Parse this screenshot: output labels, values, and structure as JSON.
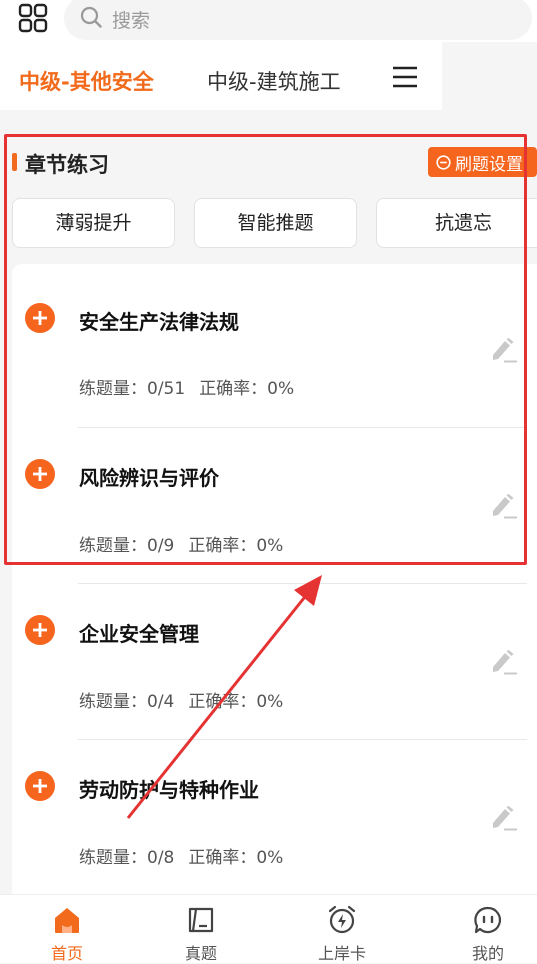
{
  "search": {
    "placeholder": "搜索"
  },
  "tabs": [
    {
      "label": "中级-其他安全",
      "active": true
    },
    {
      "label": "中级-建筑施工",
      "active": false
    }
  ],
  "section": {
    "title": "章节练习",
    "settings_label": "刷题设置"
  },
  "modes": [
    {
      "label": "薄弱提升"
    },
    {
      "label": "智能推题"
    },
    {
      "label": "抗遗忘"
    }
  ],
  "chapters": [
    {
      "title": "安全生产法律法规",
      "count_label": "练题量：0/51",
      "accuracy_label": "正确率：0%"
    },
    {
      "title": "风险辨识与评价",
      "count_label": "练题量：0/9",
      "accuracy_label": "正确率：0%"
    },
    {
      "title": "企业安全管理",
      "count_label": "练题量：0/4",
      "accuracy_label": "正确率：0%"
    },
    {
      "title": "劳动防护与特种作业",
      "count_label": "练题量：0/8",
      "accuracy_label": "正确率：0%"
    }
  ],
  "bottom_nav": [
    {
      "label": "首页",
      "icon": "home-icon",
      "active": true
    },
    {
      "label": "真题",
      "icon": "exam-paper-icon",
      "active": false
    },
    {
      "label": "上岸卡",
      "icon": "alarm-clock-bolt-icon",
      "active": false
    },
    {
      "label": "我的",
      "icon": "chat-face-icon",
      "active": false
    }
  ],
  "colors": {
    "accent": "#f26a1b",
    "annotation_red": "#e53333",
    "background": "#f5f5f5"
  }
}
